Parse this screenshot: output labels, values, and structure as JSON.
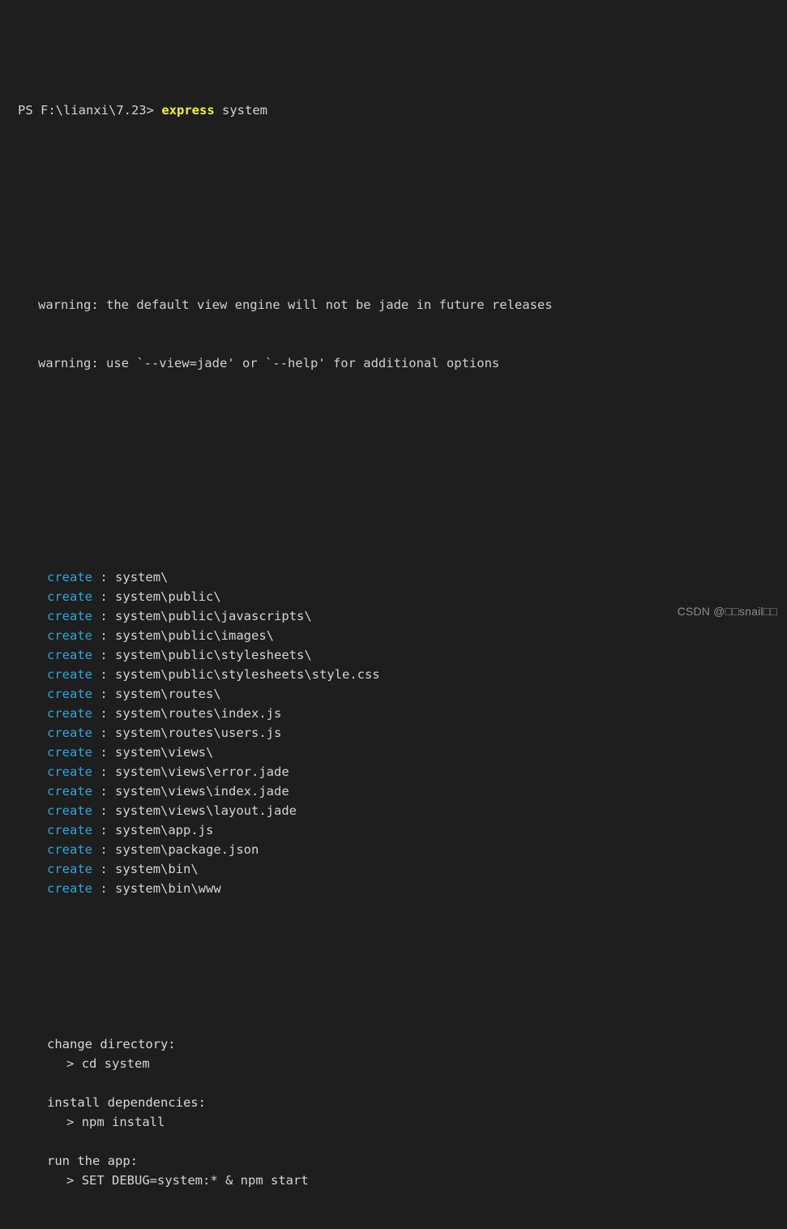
{
  "terminal": {
    "background_color": "#1e1e1e",
    "foreground_color": "#cfcfcf",
    "accent_create_color": "#29a8dc",
    "accent_command_color": "#f3f32b",
    "prompt": {
      "path": "PS F:\\lianxi\\7.23>",
      "command": "express",
      "argument": "system"
    },
    "warnings": [
      "warning: the default view engine will not be jade in future releases",
      "warning: use `--view=jade' or `--help' for additional options"
    ],
    "create_keyword": "create",
    "create_separator": ":",
    "created_paths": [
      "system\\",
      "system\\public\\",
      "system\\public\\javascripts\\",
      "system\\public\\images\\",
      "system\\public\\stylesheets\\",
      "system\\public\\stylesheets\\style.css",
      "system\\routes\\",
      "system\\routes\\index.js",
      "system\\routes\\users.js",
      "system\\views\\",
      "system\\views\\error.jade",
      "system\\views\\index.jade",
      "system\\views\\layout.jade",
      "system\\app.js",
      "system\\package.json",
      "system\\bin\\",
      "system\\bin\\www"
    ],
    "sections": [
      {
        "heading": "change directory:",
        "chevron": ">",
        "command": "cd system"
      },
      {
        "heading": "install dependencies:",
        "chevron": ">",
        "command": "npm install"
      },
      {
        "heading": "run the app:",
        "chevron": ">",
        "command": "SET DEBUG=system:* & npm start"
      }
    ]
  },
  "watermark": {
    "text": "CSDN @□□snail□□"
  }
}
